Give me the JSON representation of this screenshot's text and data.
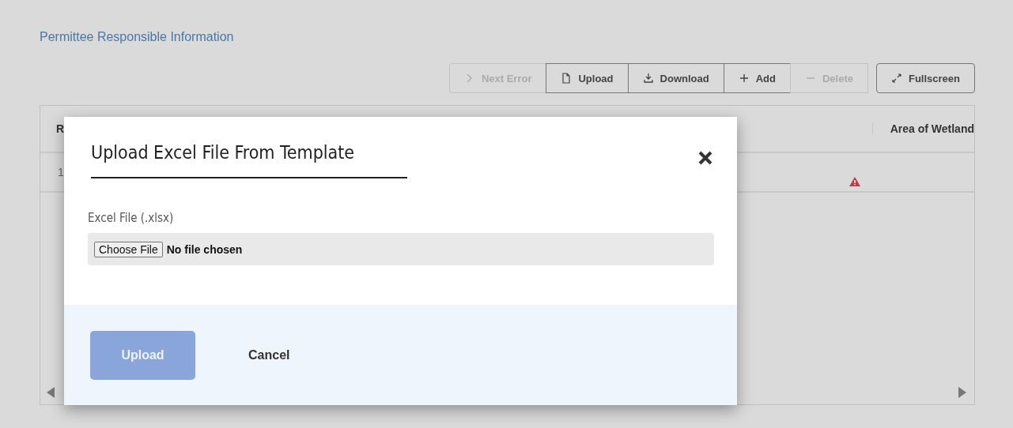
{
  "section_title": "Permittee Responsible Information",
  "toolbar": [
    {
      "kind": "next",
      "label": "Next Error",
      "disabled": true
    },
    {
      "kind": "upload",
      "label": "Upload",
      "disabled": false
    },
    {
      "kind": "download",
      "label": "Download",
      "disabled": false
    },
    {
      "kind": "add",
      "label": "Add",
      "disabled": false
    },
    {
      "kind": "delete",
      "label": "Delete",
      "disabled": true
    },
    {
      "kind": "fullscreen",
      "label": "Fullscreen",
      "disabled": false
    }
  ],
  "table": {
    "columns": [
      "R",
      "Area of Wetland"
    ],
    "rows": [
      {
        "cells": [
          "1",
          ""
        ],
        "error": true
      }
    ]
  },
  "dialog": {
    "title": "Upload Excel File From Template",
    "field_label": "Excel File (.xlsx)",
    "file_button": "Choose File",
    "file_status": "No file chosen",
    "buttons": [
      {
        "kind": "primary",
        "label": "Upload",
        "disabled": true
      },
      {
        "kind": "link",
        "label": "Cancel",
        "disabled": false
      }
    ]
  }
}
